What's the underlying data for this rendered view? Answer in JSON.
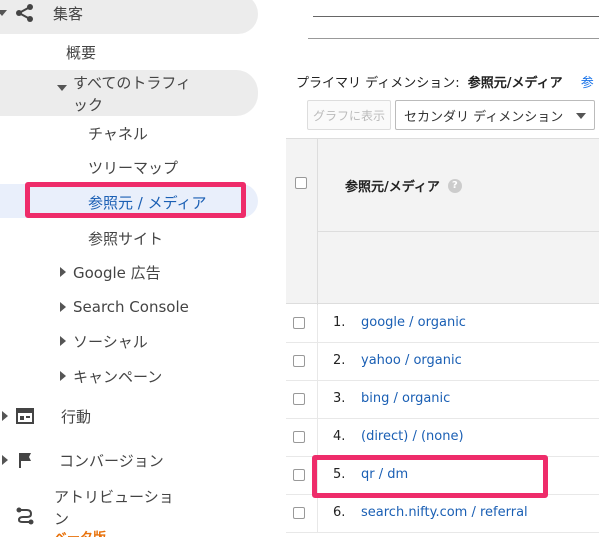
{
  "sidebar": {
    "acquisition": "集客",
    "overview": "概要",
    "all_traffic_line1": "すべてのトラフィ",
    "all_traffic_line2": "ック",
    "channels": "チャネル",
    "treemap": "ツリーマップ",
    "source_medium": "参照元 / メディア",
    "referrals": "参照サイト",
    "google_ads": "Google 広告",
    "search_console": "Search Console",
    "social": "ソーシャル",
    "campaigns": "キャンペーン",
    "behavior": "行動",
    "conversions": "コンバージョン",
    "attribution_line1": "アトリビューショ",
    "attribution_line2": "ン",
    "beta_badge": "ベータ版"
  },
  "main": {
    "primary_dimension_label": "プライマリ ディメンション:",
    "primary_dimension_value": "参照元/メディア",
    "primary_dimension_more": "参",
    "graph_button": "グラフに表示",
    "secondary_dimension": "セカンダリ ディメンション",
    "column_header": "参照元/メディア",
    "help_glyph": "?",
    "rows": [
      {
        "num": "1.",
        "source": "google / organic"
      },
      {
        "num": "2.",
        "source": "yahoo / organic"
      },
      {
        "num": "3.",
        "source": "bing / organic"
      },
      {
        "num": "4.",
        "source": "(direct) / (none)"
      },
      {
        "num": "5.",
        "source": "qr / dm"
      },
      {
        "num": "6.",
        "source": "search.nifty.com / referral"
      }
    ]
  },
  "colors": {
    "highlight": "#ee2c6a",
    "active_bg": "#e9effb",
    "link": "#1a5fb4",
    "beta": "#e8710a"
  },
  "icons": {
    "acquisition": "acquisition-icon",
    "behavior": "behavior-icon",
    "conversions": "flag-icon",
    "attribution": "attribution-icon"
  }
}
